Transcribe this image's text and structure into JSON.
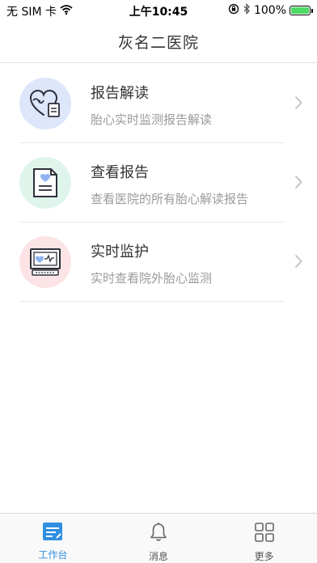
{
  "status_bar": {
    "carrier": "无 SIM 卡",
    "time": "上午10:45",
    "battery_percent": "100%",
    "battery_level": 1.0,
    "wifi_icon": "wifi-icon",
    "lock_icon": "orientation-lock-icon",
    "bluetooth_icon": "bluetooth-icon"
  },
  "nav": {
    "title": "灰名二医院"
  },
  "menu": {
    "items": [
      {
        "title": "报告解读",
        "subtitle": "胎心实时监测报告解读",
        "icon": "heart-report-icon",
        "icon_bg": "#dde6fb"
      },
      {
        "title": "查看报告",
        "subtitle": "查看医院的所有胎心解读报告",
        "icon": "document-icon",
        "icon_bg": "#dff5ec"
      },
      {
        "title": "实时监护",
        "subtitle": "实时查看院外胎心监测",
        "icon": "monitor-icon",
        "icon_bg": "#fbe3e6"
      }
    ]
  },
  "tabs": {
    "items": [
      {
        "label": "工作台",
        "icon": "workbench-icon",
        "active": true
      },
      {
        "label": "消息",
        "icon": "bell-icon",
        "active": false
      },
      {
        "label": "更多",
        "icon": "grid-icon",
        "active": false
      }
    ]
  },
  "colors": {
    "accent": "#2f8fe0",
    "text": "#333333",
    "subtext": "#9a9a9a"
  }
}
